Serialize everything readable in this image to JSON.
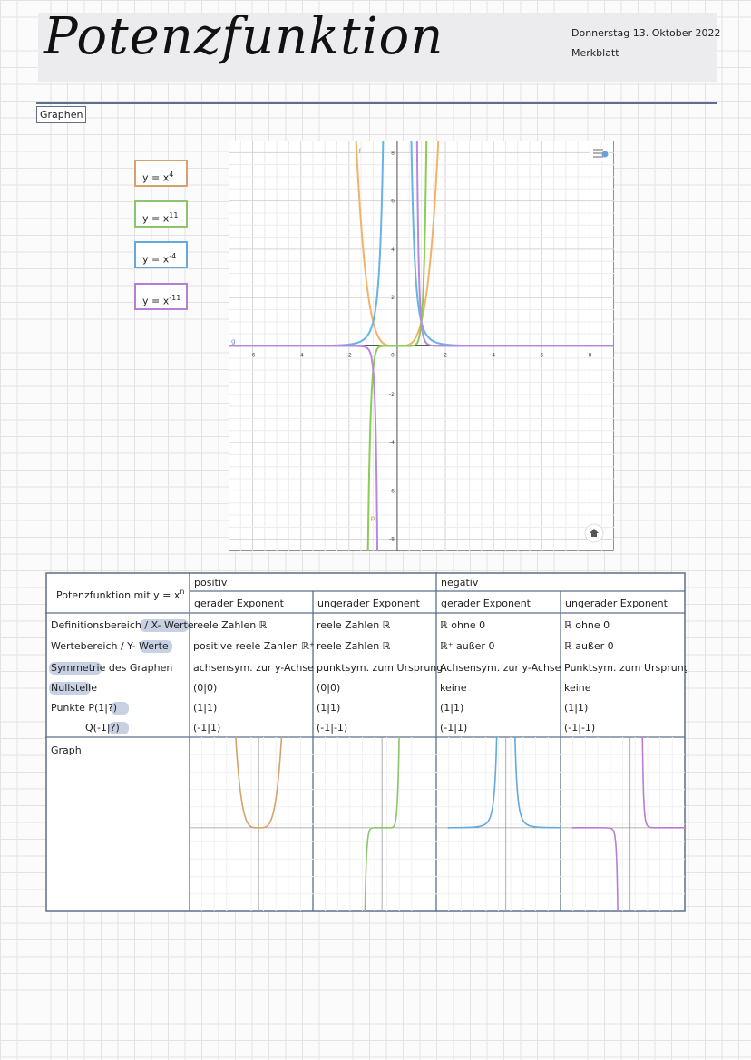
{
  "header": {
    "title": "Potenzfunktion",
    "date": "Donnerstag 13. Oktober 2022",
    "note": "Merkblatt"
  },
  "section": {
    "label": "Graphen"
  },
  "legend": [
    {
      "base": "y = x",
      "exp": "4",
      "color": "#d3a36c"
    },
    {
      "base": "y = x",
      "exp": "11",
      "color": "#8cc56b"
    },
    {
      "base": "y = x",
      "exp": "-4",
      "color": "#64a8dd"
    },
    {
      "base": "y = x",
      "exp": "-11",
      "color": "#b57fd6"
    }
  ],
  "chart_data": {
    "type": "line",
    "xlim": [
      -7,
      9
    ],
    "ylim": [
      -8.5,
      8.5
    ],
    "x_ticks": [
      "-6",
      "-4",
      "-2",
      "0",
      "2",
      "4",
      "6",
      "8"
    ],
    "y_ticks": [
      "8",
      "6",
      "4",
      "2",
      "-2",
      "-4",
      "-6",
      "-8"
    ],
    "grid": true,
    "series": [
      {
        "name": "y = x^4",
        "exponent": 4,
        "color": "#f0b36a"
      },
      {
        "name": "y = x^11",
        "exponent": 11,
        "color": "#8ccb56"
      },
      {
        "name": "y = x^-4",
        "exponent": -4,
        "color": "#66b4e6"
      },
      {
        "name": "y = x^-11",
        "exponent": -11,
        "color": "#b888e0"
      }
    ],
    "labels": {
      "top_left": "f",
      "left": "g",
      "bottom": "p"
    }
  },
  "table": {
    "header_label": "Potenzfunktion mit y = x",
    "header_exp": "n",
    "group_positive": "positiv",
    "group_negative": "negativ",
    "col_headers": [
      "gerader Exponent",
      "ungerader Exponent",
      "gerader Exponent",
      "ungerader Exponent"
    ],
    "row_labels": [
      "Definitionsbereich / X- Werte",
      "Wertebereich / Y- Werte",
      "Symmetrie des Graphen",
      "Nullstelle",
      "Punkte P(1|?)",
      "Q(-1|?)",
      "Graph"
    ],
    "rows": [
      [
        "reele Zahlen ℝ",
        "reele Zahlen ℝ",
        "ℝ ohne 0",
        "ℝ ohne 0"
      ],
      [
        "positive reele Zahlen ℝ⁺",
        "reele Zahlen ℝ",
        "ℝ⁺ außer 0",
        "ℝ außer 0"
      ],
      [
        "achsensym. zur y-Achse",
        "punktsym. zum Ursprung",
        "Achsensym. zur y-Achse",
        "Punktsym. zum Ursprung"
      ],
      [
        "(0|0)",
        "(0|0)",
        "keine",
        "keine"
      ],
      [
        "(1|1)",
        "(1|1)",
        "(1|1)",
        "(1|1)"
      ],
      [
        "(-1|1)",
        "(-1|-1)",
        "(-1|1)",
        "(-1|-1)"
      ]
    ],
    "mini_exponents": [
      4,
      11,
      -4,
      -11
    ],
    "mini_colors": [
      "#d3a36c",
      "#8cc56b",
      "#64a8dd",
      "#b57fd6"
    ]
  }
}
